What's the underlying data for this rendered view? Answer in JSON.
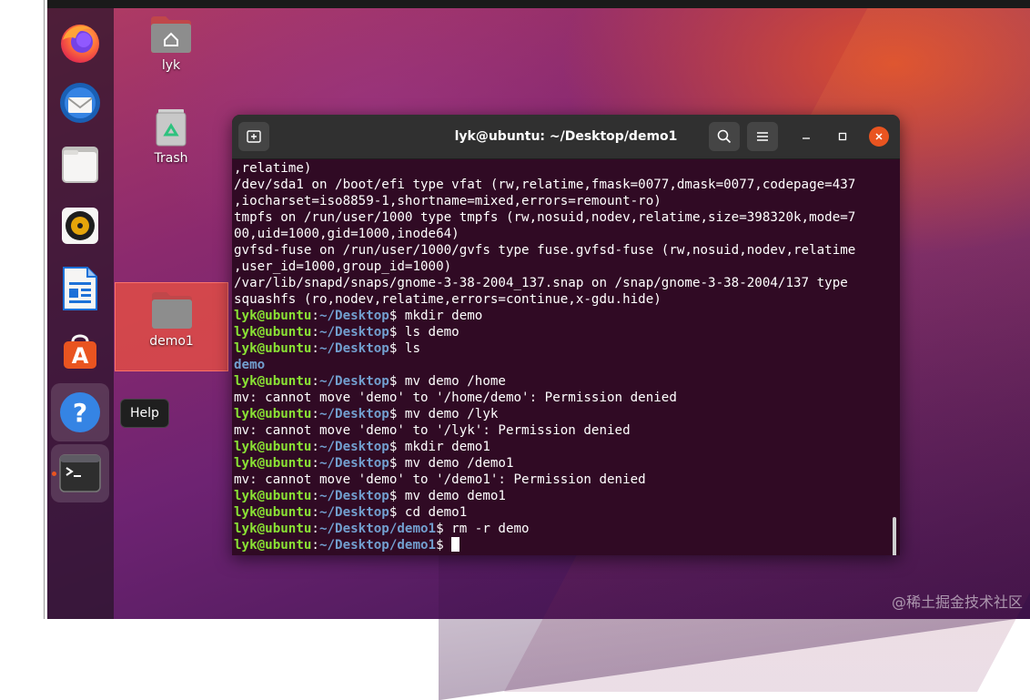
{
  "dock": {
    "items": [
      {
        "name": "firefox"
      },
      {
        "name": "thunderbird"
      },
      {
        "name": "files"
      },
      {
        "name": "rhythmbox"
      },
      {
        "name": "libreoffice-writer"
      },
      {
        "name": "ubuntu-software"
      },
      {
        "name": "help"
      },
      {
        "name": "terminal"
      }
    ],
    "tooltip": "Help"
  },
  "desktop_icons": {
    "home_label": "lyk",
    "trash_label": "Trash",
    "folder_label": "demo1"
  },
  "terminal": {
    "title": "lyk@ubuntu: ~/Desktop/demo1",
    "prompt_user": "lyk@ubuntu",
    "lines": [
      {
        "type": "out",
        "text": ",relatime)"
      },
      {
        "type": "out",
        "text": "/dev/sda1 on /boot/efi type vfat (rw,relatime,fmask=0077,dmask=0077,codepage=437"
      },
      {
        "type": "out",
        "text": ",iocharset=iso8859-1,shortname=mixed,errors=remount-ro)"
      },
      {
        "type": "out",
        "text": "tmpfs on /run/user/1000 type tmpfs (rw,nosuid,nodev,relatime,size=398320k,mode=7"
      },
      {
        "type": "out",
        "text": "00,uid=1000,gid=1000,inode64)"
      },
      {
        "type": "out",
        "text": "gvfsd-fuse on /run/user/1000/gvfs type fuse.gvfsd-fuse (rw,nosuid,nodev,relatime"
      },
      {
        "type": "out",
        "text": ",user_id=1000,group_id=1000)"
      },
      {
        "type": "out",
        "text": "/var/lib/snapd/snaps/gnome-3-38-2004_137.snap on /snap/gnome-3-38-2004/137 type"
      },
      {
        "type": "out",
        "text": "squashfs (ro,nodev,relatime,errors=continue,x-gdu.hide)"
      },
      {
        "type": "cmd",
        "path": "~/Desktop",
        "cmd": " mkdir demo"
      },
      {
        "type": "cmd",
        "path": "~/Desktop",
        "cmd": " ls demo"
      },
      {
        "type": "cmd",
        "path": "~/Desktop",
        "cmd": " ls"
      },
      {
        "type": "dir",
        "text": "demo"
      },
      {
        "type": "cmd",
        "path": "~/Desktop",
        "cmd": " mv demo /home"
      },
      {
        "type": "out",
        "text": "mv: cannot move 'demo' to '/home/demo': Permission denied"
      },
      {
        "type": "cmd",
        "path": "~/Desktop",
        "cmd": " mv demo /lyk"
      },
      {
        "type": "out",
        "text": "mv: cannot move 'demo' to '/lyk': Permission denied"
      },
      {
        "type": "cmd",
        "path": "~/Desktop",
        "cmd": " mkdir demo1"
      },
      {
        "type": "cmd",
        "path": "~/Desktop",
        "cmd": " mv demo /demo1"
      },
      {
        "type": "out",
        "text": "mv: cannot move 'demo' to '/demo1': Permission denied"
      },
      {
        "type": "cmd",
        "path": "~/Desktop",
        "cmd": " mv demo demo1"
      },
      {
        "type": "cmd",
        "path": "~/Desktop",
        "cmd": " cd demo1"
      },
      {
        "type": "cmd",
        "path": "~/Desktop/demo1",
        "cmd": " rm -r demo"
      },
      {
        "type": "cmd",
        "path": "~/Desktop/demo1",
        "cmd": " ",
        "cursor": true
      }
    ]
  },
  "watermark": "@稀土掘金技术社区",
  "colors": {
    "accent": "#e95420",
    "terminal_bg": "#300a24",
    "prompt_user": "#8ae234",
    "prompt_path": "#729fcf"
  }
}
